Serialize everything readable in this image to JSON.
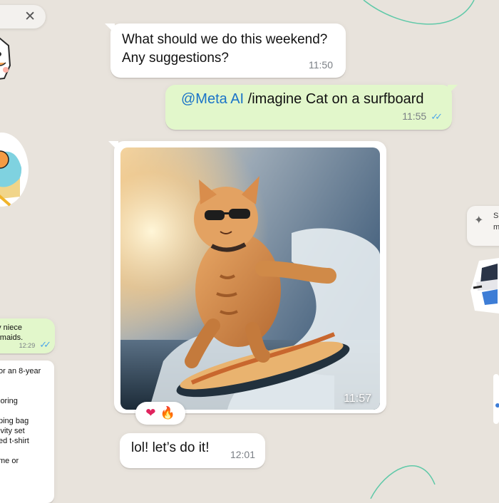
{
  "chat": {
    "messages": {
      "question": {
        "text_line1": "What should we do this weekend?",
        "text_line2": "Any suggestions?",
        "time": "11:50"
      },
      "prompt": {
        "mention": "@Meta AI",
        "command": " /imagine Cat on a surfboard",
        "time": "11:55",
        "ticks": "✓✓"
      },
      "image": {
        "time": "11:57"
      },
      "reply": {
        "text": "lol! let’s do it!",
        "time": "12:01"
      }
    },
    "reactions": [
      "❤",
      "🔥"
    ]
  },
  "left_panel": {
    "close_chip": {
      "icon": "close-icon",
      "symbol": "✕"
    },
    "out_bubble": {
      "line1": "ny niece",
      "line2": "ermaids.",
      "time": "12:29",
      "ticks": "✓✓"
    },
    "list_lines": [
      "or an 8-year",
      "",
      "",
      "loring",
      "",
      "ping bag",
      "ivity set",
      "ed t-shirt",
      "",
      "me or"
    ]
  },
  "right_panel": {
    "chip": {
      "icon": "sparkle-icon",
      "line1": "S",
      "line2": "m"
    }
  },
  "colors": {
    "background": "#e8e3dc",
    "incoming": "#ffffff",
    "outgoing": "#e2f7cb",
    "mention": "#1a73c8",
    "read_ticks": "#4fa7ea"
  }
}
